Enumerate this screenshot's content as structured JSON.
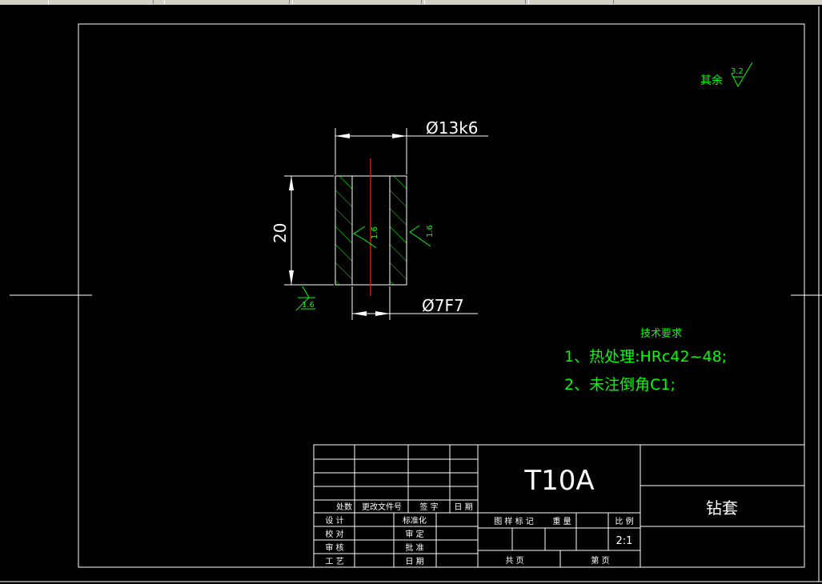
{
  "drawing": {
    "roughness_default_label": "其余",
    "roughness_default_value": "3.2",
    "dim_outer_diameter": "Ø13k6",
    "dim_inner_diameter": "Ø7F7",
    "dim_length": "20",
    "roughness_inner": "1.6",
    "roughness_outer": "1.6",
    "roughness_end": "1.6"
  },
  "tech_requirements": {
    "heading": "技术要求",
    "item1": "1、热处理:HRc42~48;",
    "item2": "2、未注倒角C1;"
  },
  "title_block": {
    "material": "T10A",
    "part_name": "钻套",
    "rev_headers": [
      "处数",
      "更改文件号",
      "签 字",
      "日 期"
    ],
    "sign_labels": [
      "设 计",
      "校 对",
      "审 核",
      "工 艺"
    ],
    "sign_labels2": [
      "标准化",
      "审 定",
      "批 准",
      "日 期"
    ],
    "attr_labels": [
      "图 样 标 记",
      "重 量",
      "比 例"
    ],
    "scale": "2:1",
    "sheet_total": "共 页",
    "sheet_no": "第 页"
  },
  "colors": {
    "background": "#000000",
    "lines": "#ffffff",
    "annotation": "#00ff00",
    "centerline": "#ff2020"
  }
}
